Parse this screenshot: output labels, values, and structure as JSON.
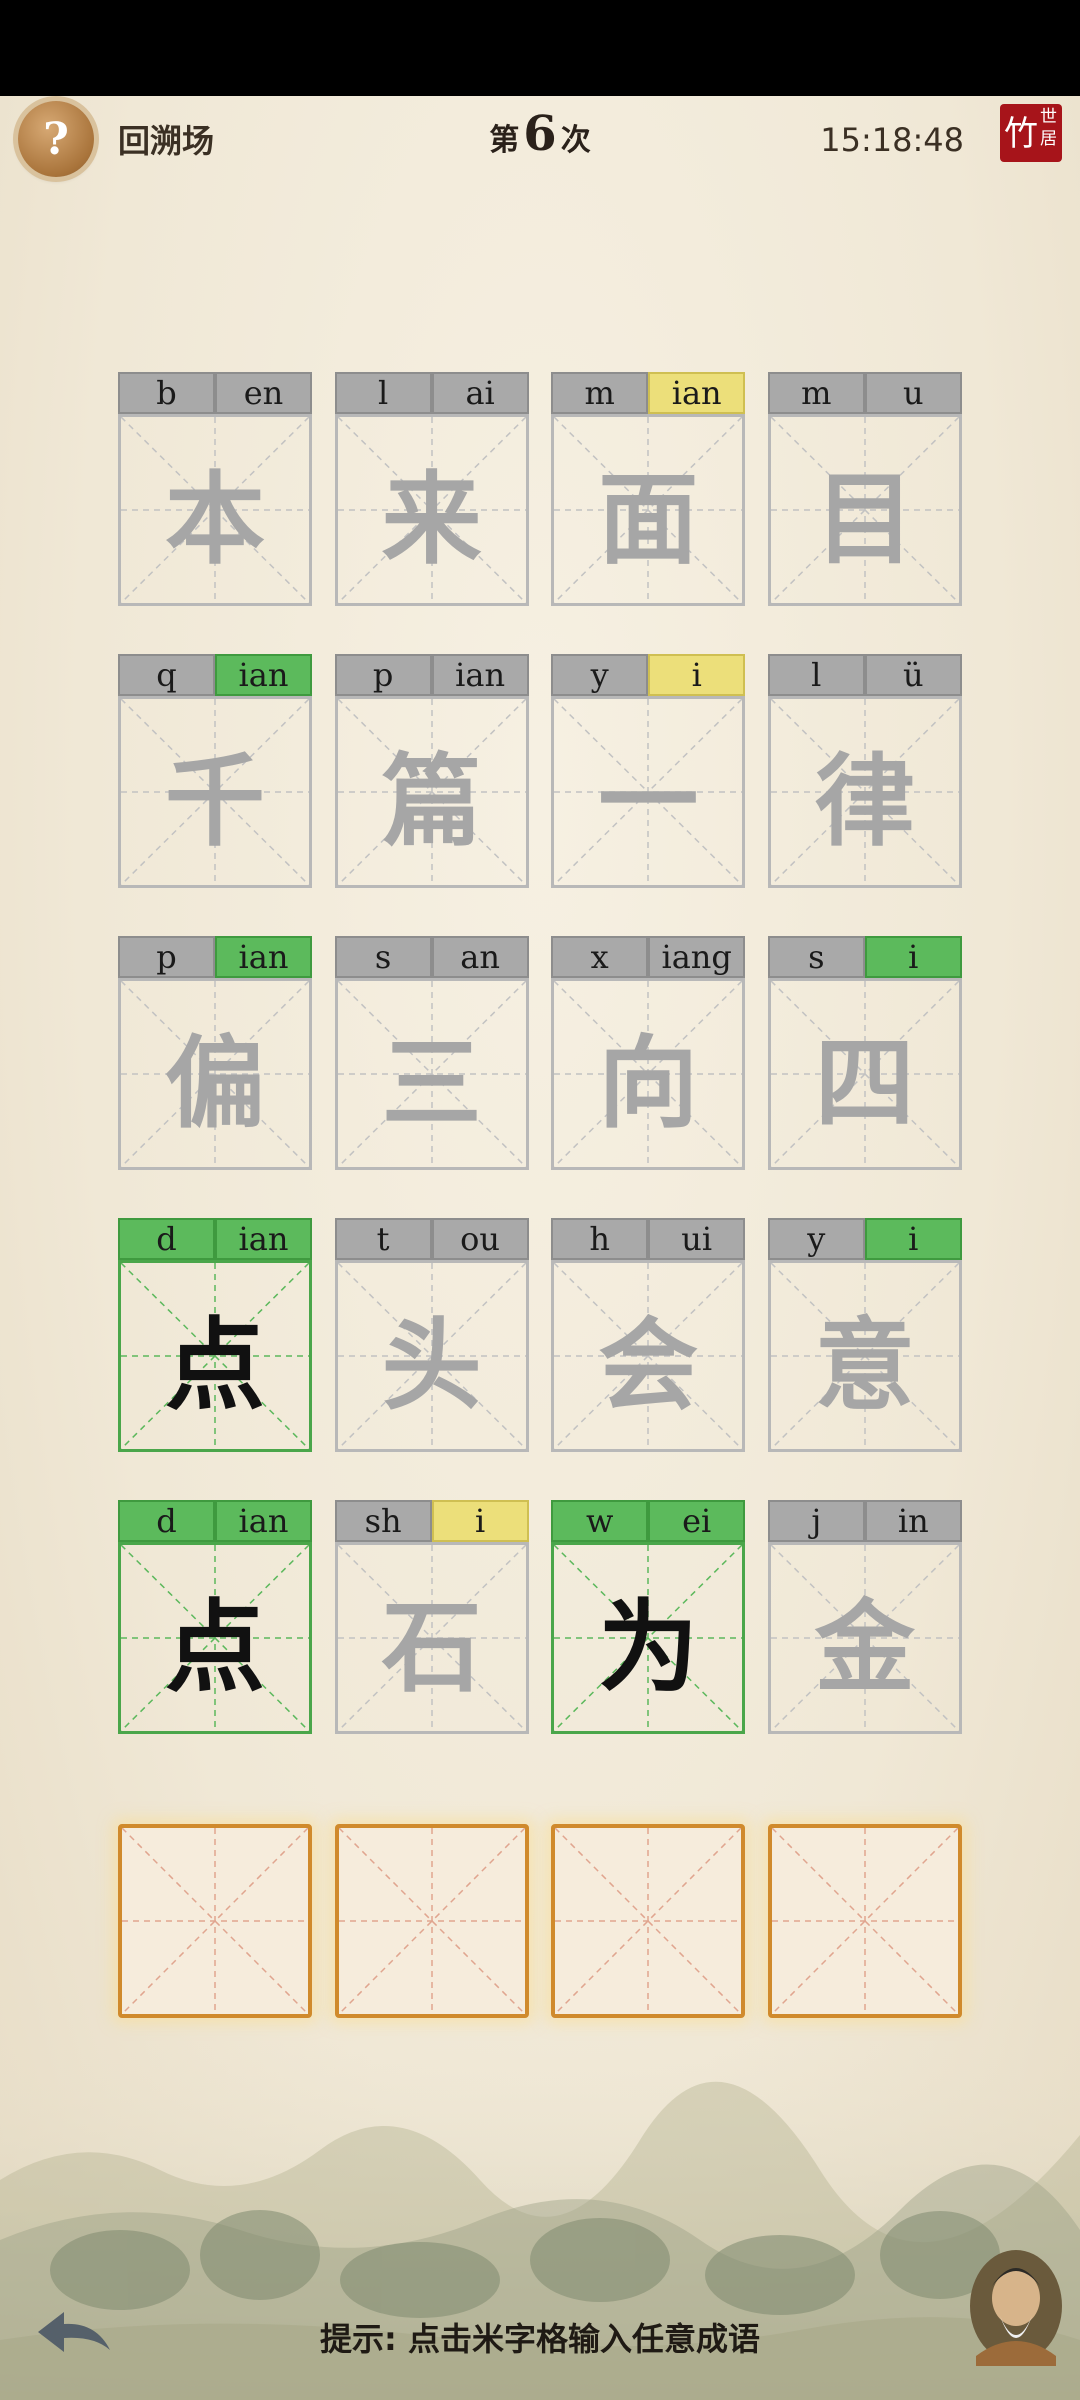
{
  "header": {
    "help_icon_glyph": "?",
    "back_label": "回溯场",
    "round_prefix": "第",
    "round_number": "6",
    "round_suffix": "次",
    "clock": "15:18:48",
    "logo_big": "竹",
    "logo_small_1": "世",
    "logo_small_2": "居"
  },
  "colors": {
    "green": "#5cba5c",
    "yellow": "#ecdf7a",
    "gray": "#a9a9a9",
    "answer_border": "#d08a2c"
  },
  "guesses": [
    {
      "cells": [
        {
          "initial": "b",
          "final": "en",
          "ini_state": "gray",
          "fin_state": "gray",
          "char": "本",
          "char_state": "gray"
        },
        {
          "initial": "l",
          "final": "ai",
          "ini_state": "gray",
          "fin_state": "gray",
          "char": "来",
          "char_state": "gray"
        },
        {
          "initial": "m",
          "final": "ian",
          "ini_state": "gray",
          "fin_state": "yellow",
          "char": "面",
          "char_state": "gray"
        },
        {
          "initial": "m",
          "final": "u",
          "ini_state": "gray",
          "fin_state": "gray",
          "char": "目",
          "char_state": "gray"
        }
      ]
    },
    {
      "cells": [
        {
          "initial": "q",
          "final": "ian",
          "ini_state": "gray",
          "fin_state": "green",
          "char": "千",
          "char_state": "gray"
        },
        {
          "initial": "p",
          "final": "ian",
          "ini_state": "gray",
          "fin_state": "gray",
          "char": "篇",
          "char_state": "gray"
        },
        {
          "initial": "y",
          "final": "i",
          "ini_state": "gray",
          "fin_state": "yellow",
          "char": "一",
          "char_state": "gray"
        },
        {
          "initial": "l",
          "final": "ü",
          "ini_state": "gray",
          "fin_state": "gray",
          "char": "律",
          "char_state": "gray"
        }
      ]
    },
    {
      "cells": [
        {
          "initial": "p",
          "final": "ian",
          "ini_state": "gray",
          "fin_state": "green",
          "char": "偏",
          "char_state": "gray"
        },
        {
          "initial": "s",
          "final": "an",
          "ini_state": "gray",
          "fin_state": "gray",
          "char": "三",
          "char_state": "gray"
        },
        {
          "initial": "x",
          "final": "iang",
          "ini_state": "gray",
          "fin_state": "gray",
          "char": "向",
          "char_state": "gray"
        },
        {
          "initial": "s",
          "final": "i",
          "ini_state": "gray",
          "fin_state": "green",
          "char": "四",
          "char_state": "gray"
        }
      ]
    },
    {
      "cells": [
        {
          "initial": "d",
          "final": "ian",
          "ini_state": "green",
          "fin_state": "green",
          "char": "点",
          "char_state": "green"
        },
        {
          "initial": "t",
          "final": "ou",
          "ini_state": "gray",
          "fin_state": "gray",
          "char": "头",
          "char_state": "gray"
        },
        {
          "initial": "h",
          "final": "ui",
          "ini_state": "gray",
          "fin_state": "gray",
          "char": "会",
          "char_state": "gray"
        },
        {
          "initial": "y",
          "final": "i",
          "ini_state": "gray",
          "fin_state": "green",
          "char": "意",
          "char_state": "gray"
        }
      ]
    },
    {
      "cells": [
        {
          "initial": "d",
          "final": "ian",
          "ini_state": "green",
          "fin_state": "green",
          "char": "点",
          "char_state": "green"
        },
        {
          "initial": "sh",
          "final": "i",
          "ini_state": "gray",
          "fin_state": "yellow",
          "char": "石",
          "char_state": "gray"
        },
        {
          "initial": "w",
          "final": "ei",
          "ini_state": "green",
          "fin_state": "green",
          "char": "为",
          "char_state": "green"
        },
        {
          "initial": "j",
          "final": "in",
          "ini_state": "gray",
          "fin_state": "gray",
          "char": "金",
          "char_state": "gray"
        }
      ]
    }
  ],
  "answer_slots": [
    "",
    "",
    "",
    ""
  ],
  "hint": "提示: 点击米字格输入任意成语"
}
